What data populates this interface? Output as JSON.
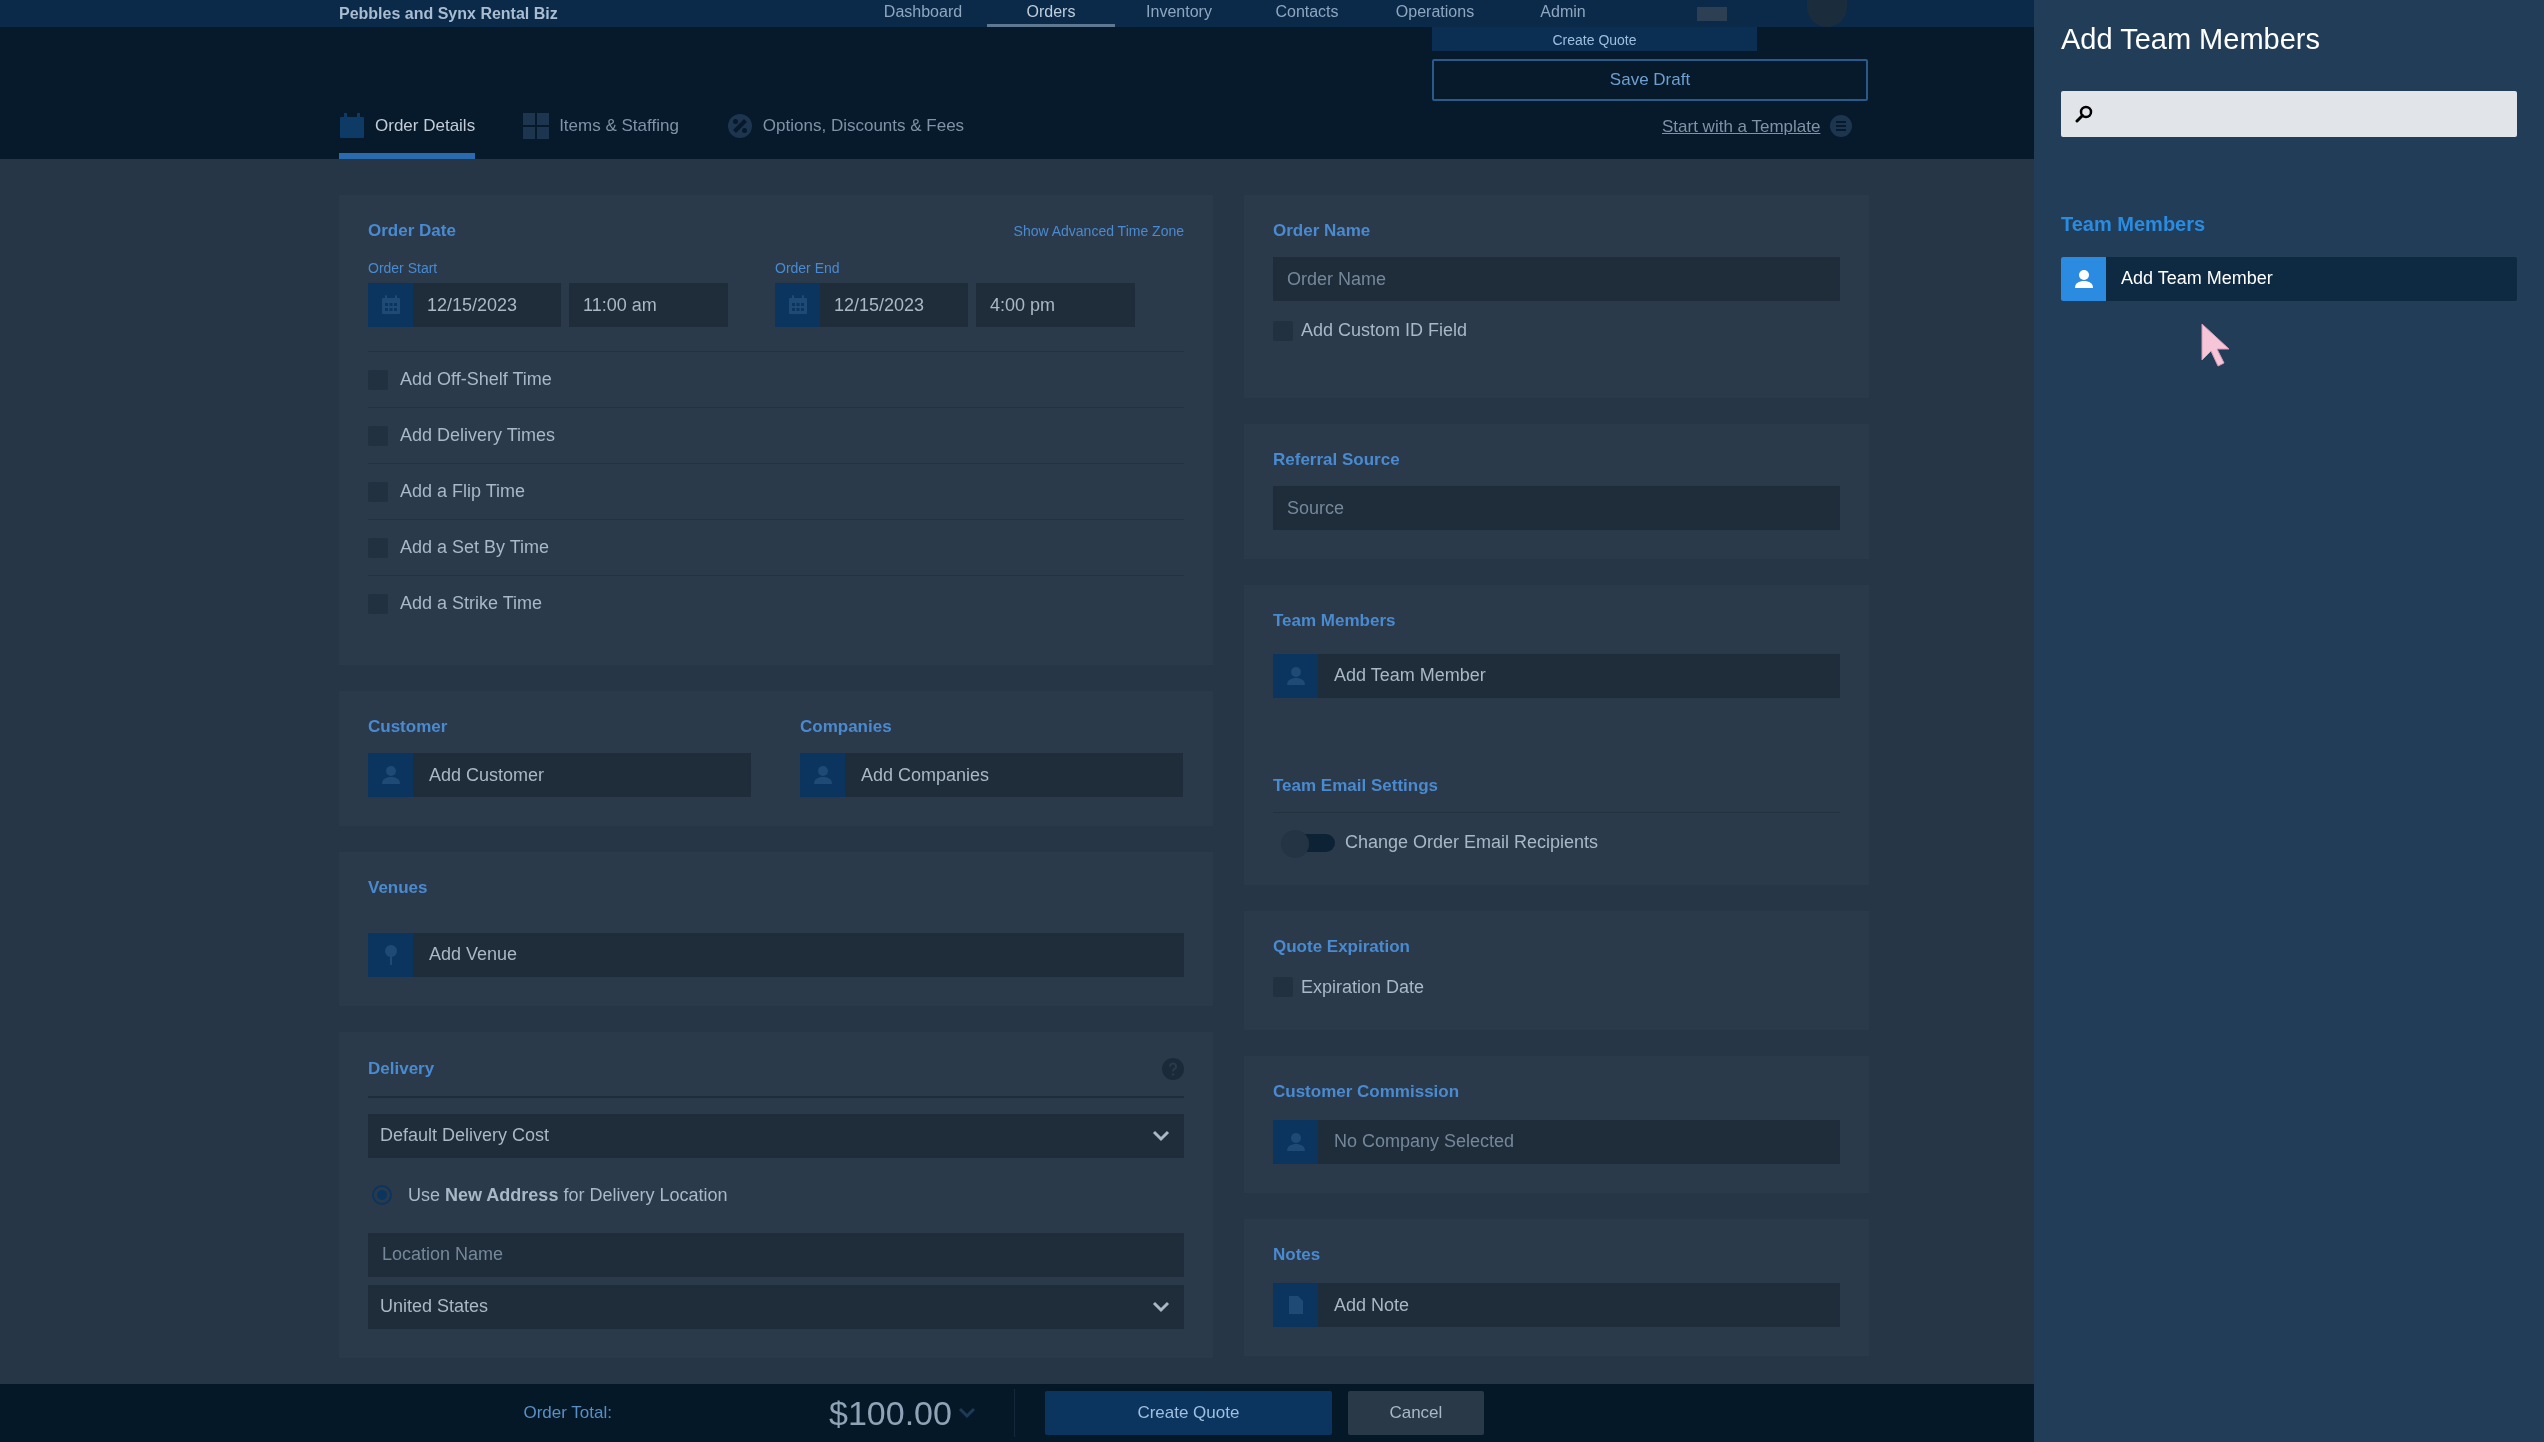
{
  "top_nav": {
    "brand": "Pebbles and Synx Rental Biz",
    "items": [
      {
        "label": "Dashboard",
        "selected": false
      },
      {
        "label": "Orders",
        "selected": true
      },
      {
        "label": "Inventory",
        "selected": false
      },
      {
        "label": "Contacts",
        "selected": false
      },
      {
        "label": "Operations",
        "selected": false
      },
      {
        "label": "Admin",
        "selected": false
      }
    ]
  },
  "header": {
    "primary_button": "Create Quote",
    "save_button": "Save Draft",
    "template_link": "Start with a Template"
  },
  "tabs": [
    {
      "label": "Order Details",
      "selected": true
    },
    {
      "label": "Items & Staffing",
      "selected": false
    },
    {
      "label": "Options, Discounts & Fees",
      "selected": false
    }
  ],
  "order_date": {
    "title": "Order Date",
    "advanced_link": "Show Advanced Time Zone",
    "start": {
      "label": "Order Start",
      "date": "12/15/2023",
      "time": "11:00 am"
    },
    "end": {
      "label": "Order End",
      "date": "12/15/2023",
      "time": "4:00 pm"
    },
    "options": [
      {
        "label": "Add Off-Shelf Time",
        "checked": false
      },
      {
        "label": "Add Delivery Times",
        "checked": false
      },
      {
        "label": "Add a Flip Time",
        "checked": false
      },
      {
        "label": "Add a Set By Time",
        "checked": false
      },
      {
        "label": "Add a Strike Time",
        "checked": false
      }
    ]
  },
  "customer": {
    "title": "Customer",
    "label": "Add Customer"
  },
  "companies": {
    "title": "Companies",
    "label": "Add Companies"
  },
  "venues": {
    "title": "Venues",
    "label": "Add Venue"
  },
  "delivery": {
    "title": "Delivery",
    "cost_select": "Default Delivery Cost",
    "address_option": {
      "text": "Use **New Address** for Delivery Location",
      "selected": true
    },
    "location_placeholder": "Location Name",
    "country_select": "United States"
  },
  "order_name": {
    "title": "Order Name",
    "placeholder": "Order Name",
    "custom_id": {
      "label": "Add Custom ID Field",
      "checked": false
    }
  },
  "referral_source": {
    "title": "Referral Source",
    "placeholder": "Source"
  },
  "team_members": {
    "title": "Team Members",
    "label": "Add Team Member"
  },
  "team_email_settings": {
    "title": "Team Email Settings",
    "toggle": {
      "label": "Change Order Email Recipients",
      "on": false
    }
  },
  "quote_expiration": {
    "title": "Quote Expiration",
    "option": {
      "label": "Expiration Date",
      "checked": false
    }
  },
  "customer_commission": {
    "title": "Customer Commission",
    "placeholder": "No Company Selected"
  },
  "notes": {
    "title": "Notes",
    "label": "Add Note"
  },
  "footer": {
    "total_label": "Order Total:",
    "total": "$100.00",
    "buttons": [
      {
        "label": "Create Quote",
        "kind": "primary"
      },
      {
        "label": "Cancel",
        "kind": "secondary"
      }
    ]
  },
  "panel": {
    "title": "Add Team Members",
    "section_title": "Team Members",
    "items": [
      {
        "label": "Add Team Member"
      }
    ]
  }
}
